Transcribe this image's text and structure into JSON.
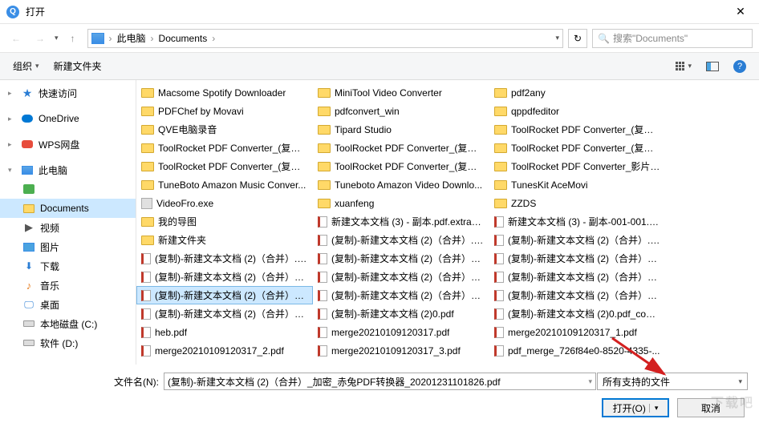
{
  "title": "打开",
  "breadcrumb": {
    "seg1": "此电脑",
    "seg2": "Documents"
  },
  "search": {
    "placeholder": "搜索\"Documents\""
  },
  "toolbar": {
    "organize": "组织",
    "newfolder": "新建文件夹"
  },
  "sidebar": {
    "quick": "快速访问",
    "onedrive": "OneDrive",
    "wps": "WPS网盘",
    "thispc": "此电脑",
    "documents": "Documents",
    "video": "视频",
    "pictures": "图片",
    "downloads": "下载",
    "music": "音乐",
    "desktop": "桌面",
    "diskc": "本地磁盘 (C:)",
    "diskd": "软件 (D:)"
  },
  "col1": [
    {
      "t": "folder",
      "n": "Macsome Spotify Downloader"
    },
    {
      "t": "folder",
      "n": "PDFChef by Movavi"
    },
    {
      "t": "folder",
      "n": "QVE电脑录音"
    },
    {
      "t": "folder",
      "n": "ToolRocket PDF Converter_(复制)..."
    },
    {
      "t": "folder",
      "n": "ToolRocket PDF Converter_(复制)..."
    },
    {
      "t": "folder",
      "n": "TuneBoto Amazon Music Conver..."
    },
    {
      "t": "exe",
      "n": "VideoFro.exe"
    },
    {
      "t": "folder",
      "n": "我的导图"
    },
    {
      "t": "folder",
      "n": "新建文件夹"
    },
    {
      "t": "pdf",
      "n": "(复制)-新建文本文档 (2)（合并）.p..."
    },
    {
      "t": "pdf",
      "n": "(复制)-新建文本文档 (2)（合并）_加..."
    },
    {
      "t": "pdf",
      "n": "(复制)-新建文本文档 (2)（合并）_加...",
      "sel": true
    },
    {
      "t": "pdf",
      "n": "(复制)-新建文本文档 (2)（合并）_已..."
    },
    {
      "t": "pdf",
      "n": "heb.pdf"
    },
    {
      "t": "pdf",
      "n": "merge20210109120317_2.pdf"
    }
  ],
  "col2": [
    {
      "t": "folder",
      "n": "MiniTool Video Converter"
    },
    {
      "t": "folder",
      "n": "pdfconvert_win"
    },
    {
      "t": "folder",
      "n": "Tipard Studio"
    },
    {
      "t": "folder",
      "n": "ToolRocket PDF Converter_(复制)..."
    },
    {
      "t": "folder",
      "n": "ToolRocket PDF Converter_(复制)..."
    },
    {
      "t": "folder",
      "n": "Tuneboto Amazon Video Downlo..."
    },
    {
      "t": "folder",
      "n": "xuanfeng"
    },
    {
      "t": "pdf",
      "n": "新建文本文档 (3) - 副本.pdf.extract..."
    },
    {
      "t": "pdf",
      "n": "(复制)-新建文本文档 (2)（合并）.pdf"
    },
    {
      "t": "pdf",
      "n": "(复制)-新建文本文档 (2)（合并）_1..."
    },
    {
      "t": "pdf",
      "n": "(复制)-新建文本文档 (2)（合并）_加..."
    },
    {
      "t": "pdf",
      "n": "(复制)-新建文本文档 (2)（合并）_加..."
    },
    {
      "t": "pdf",
      "n": "(复制)-新建文本文档 (2)0.pdf"
    },
    {
      "t": "pdf",
      "n": "merge20210109120317.pdf"
    },
    {
      "t": "pdf",
      "n": "merge20210109120317_3.pdf"
    }
  ],
  "col3": [
    {
      "t": "folder",
      "n": "pdf2any"
    },
    {
      "t": "folder",
      "n": "qppdfeditor"
    },
    {
      "t": "folder",
      "n": "ToolRocket PDF Converter_(复制)..."
    },
    {
      "t": "folder",
      "n": "ToolRocket PDF Converter_(复制)..."
    },
    {
      "t": "folder",
      "n": "ToolRocket PDF Converter_影片_s..."
    },
    {
      "t": "folder",
      "n": "TunesKit AceMovi"
    },
    {
      "t": "folder",
      "n": "ZZDS"
    },
    {
      "t": "pdf",
      "n": "新建文本文档 (3) - 副本-001-001.p..."
    },
    {
      "t": "pdf",
      "n": "(复制)-新建文本文档 (2)（合并）.p..."
    },
    {
      "t": "pdf",
      "n": "(复制)-新建文本文档 (2)（合并）_c..."
    },
    {
      "t": "pdf",
      "n": "(复制)-新建文本文档 (2)（合并）_加..."
    },
    {
      "t": "pdf",
      "n": "(复制)-新建文本文档 (2)（合并）_已..."
    },
    {
      "t": "pdf",
      "n": "(复制)-新建文本文档 (2)0.pdf_com..."
    },
    {
      "t": "pdf",
      "n": "merge20210109120317_1.pdf"
    },
    {
      "t": "pdf",
      "n": "pdf_merge_726f84e0-8520-4335-..."
    }
  ],
  "filename": {
    "label": "文件名(N):",
    "value": "(复制)-新建文本文档 (2)（合并）_加密_赤兔PDF转换器_20201231101826.pdf"
  },
  "filetype": "所有支持的文件",
  "buttons": {
    "open": "打开(O)",
    "cancel": "取消"
  },
  "watermark": "下载吧"
}
